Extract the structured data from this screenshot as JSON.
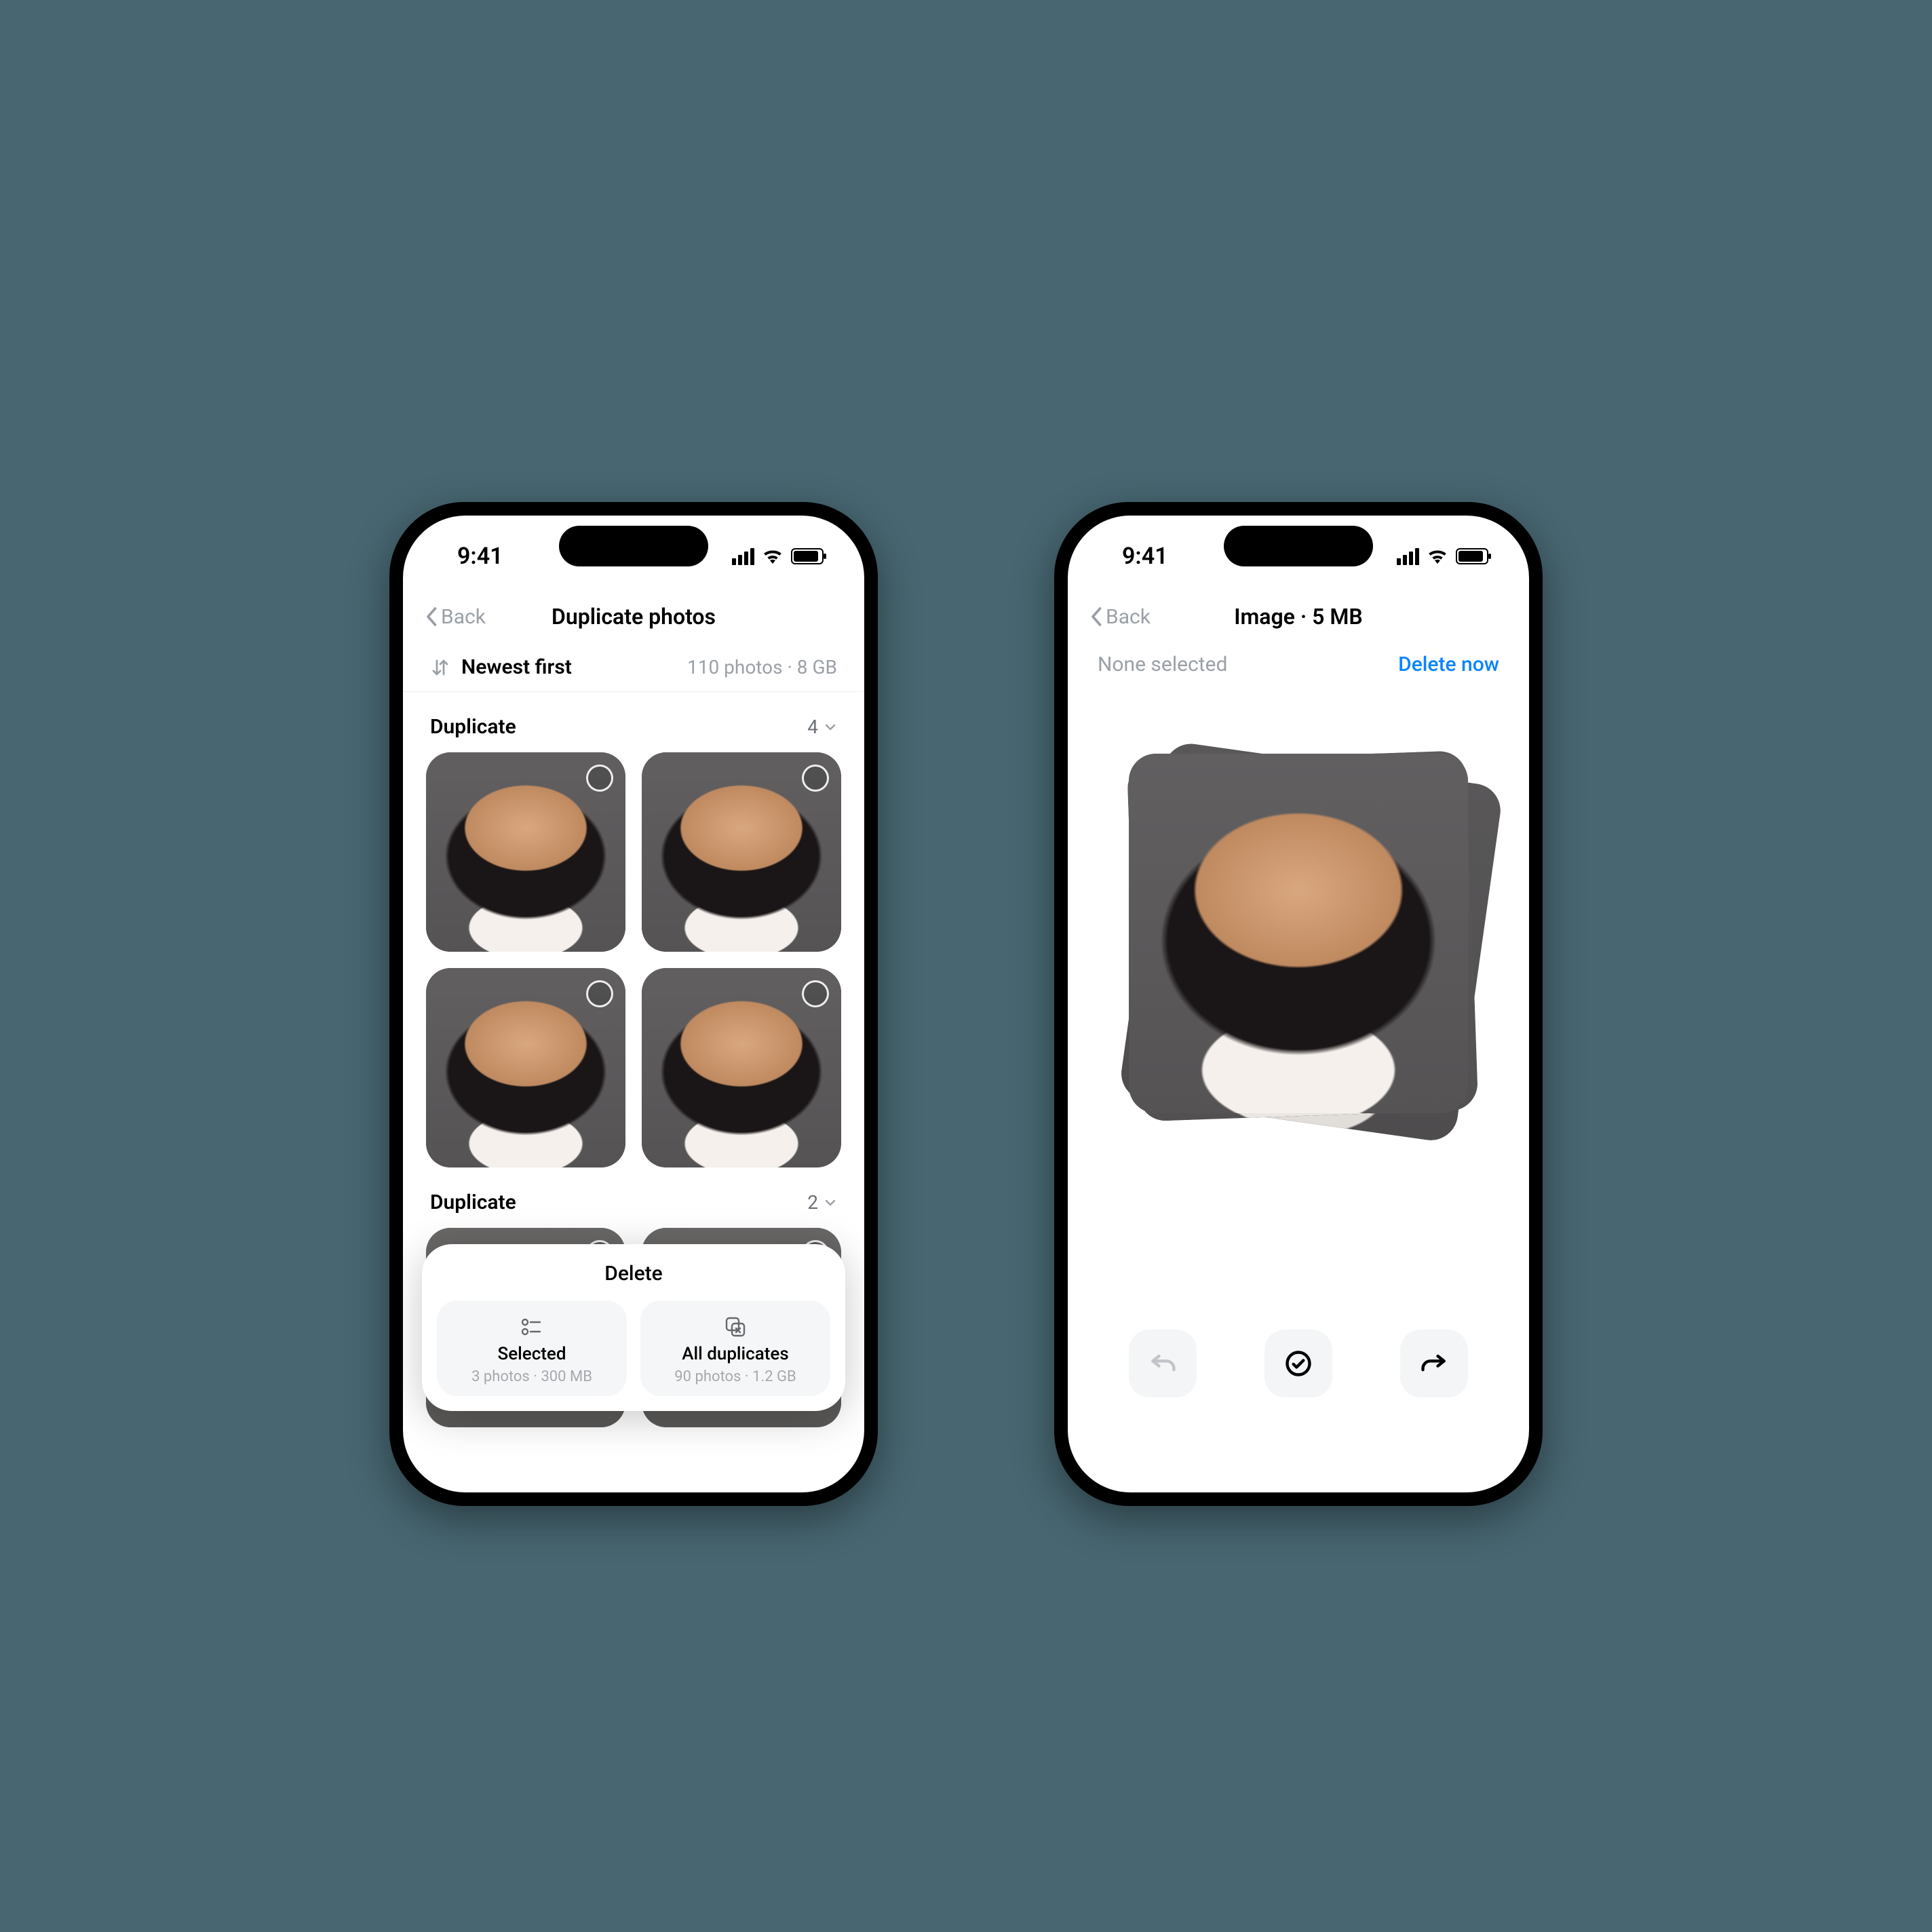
{
  "status": {
    "time": "9:41"
  },
  "left": {
    "back": "Back",
    "title": "Duplicate photos",
    "sort": "Newest first",
    "summary": "110 photos · 8 GB",
    "groups": [
      {
        "label": "Duplicate",
        "count": "4"
      },
      {
        "label": "Duplicate",
        "count": "2"
      }
    ],
    "sheet": {
      "title": "Delete",
      "selected": {
        "label": "Selected",
        "sub": "3 photos · 300 MB"
      },
      "all": {
        "label": "All duplicates",
        "sub": "90 photos · 1.2 GB"
      }
    }
  },
  "right": {
    "back": "Back",
    "title": "Image · 5 MB",
    "none": "None selected",
    "delete": "Delete now"
  }
}
